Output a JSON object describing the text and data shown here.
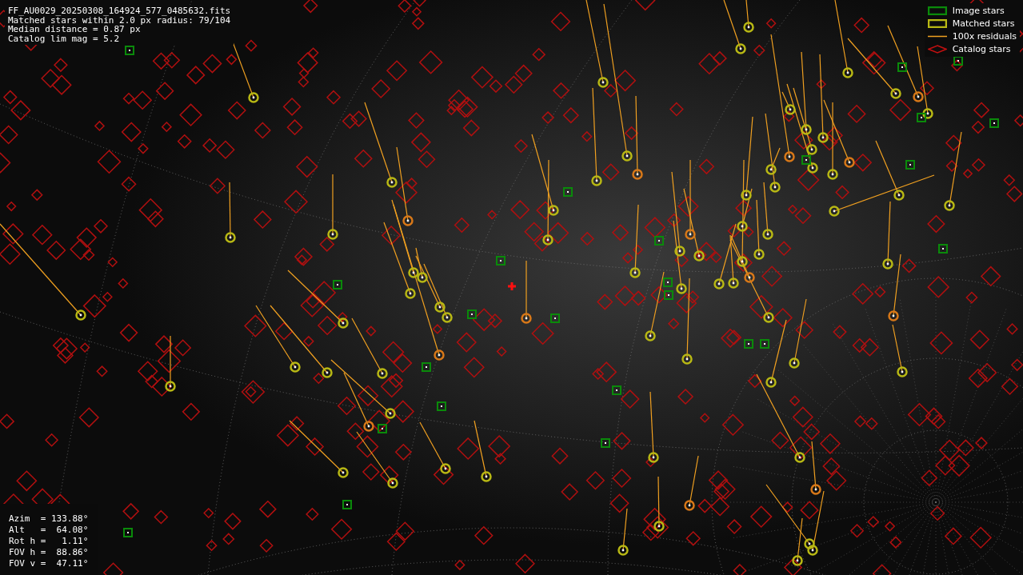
{
  "info": {
    "lines": [
      "FF_AU0029_20250308_164924_577_0485632.fits",
      "Matched stars within 2.0 px radius: 79/104",
      "Median distance = 0.87 px",
      "Catalog lim mag = 5.2"
    ]
  },
  "legend": [
    {
      "kind": "box",
      "label": "Image stars",
      "color": "#0a8a0a"
    },
    {
      "kind": "box",
      "label": "Matched stars",
      "color": "#b8b814"
    },
    {
      "kind": "line",
      "label": "100x residuals",
      "color": "#f0a020"
    },
    {
      "kind": "diamond",
      "label": "Catalog stars",
      "color": "#c01010"
    }
  ],
  "pointing": {
    "lines": [
      "Azim  = 133.88°",
      "Alt   =  64.08°",
      "Rot h =   1.11°",
      "FOV h =  88.86°",
      "FOV v =  47.11°"
    ]
  }
}
